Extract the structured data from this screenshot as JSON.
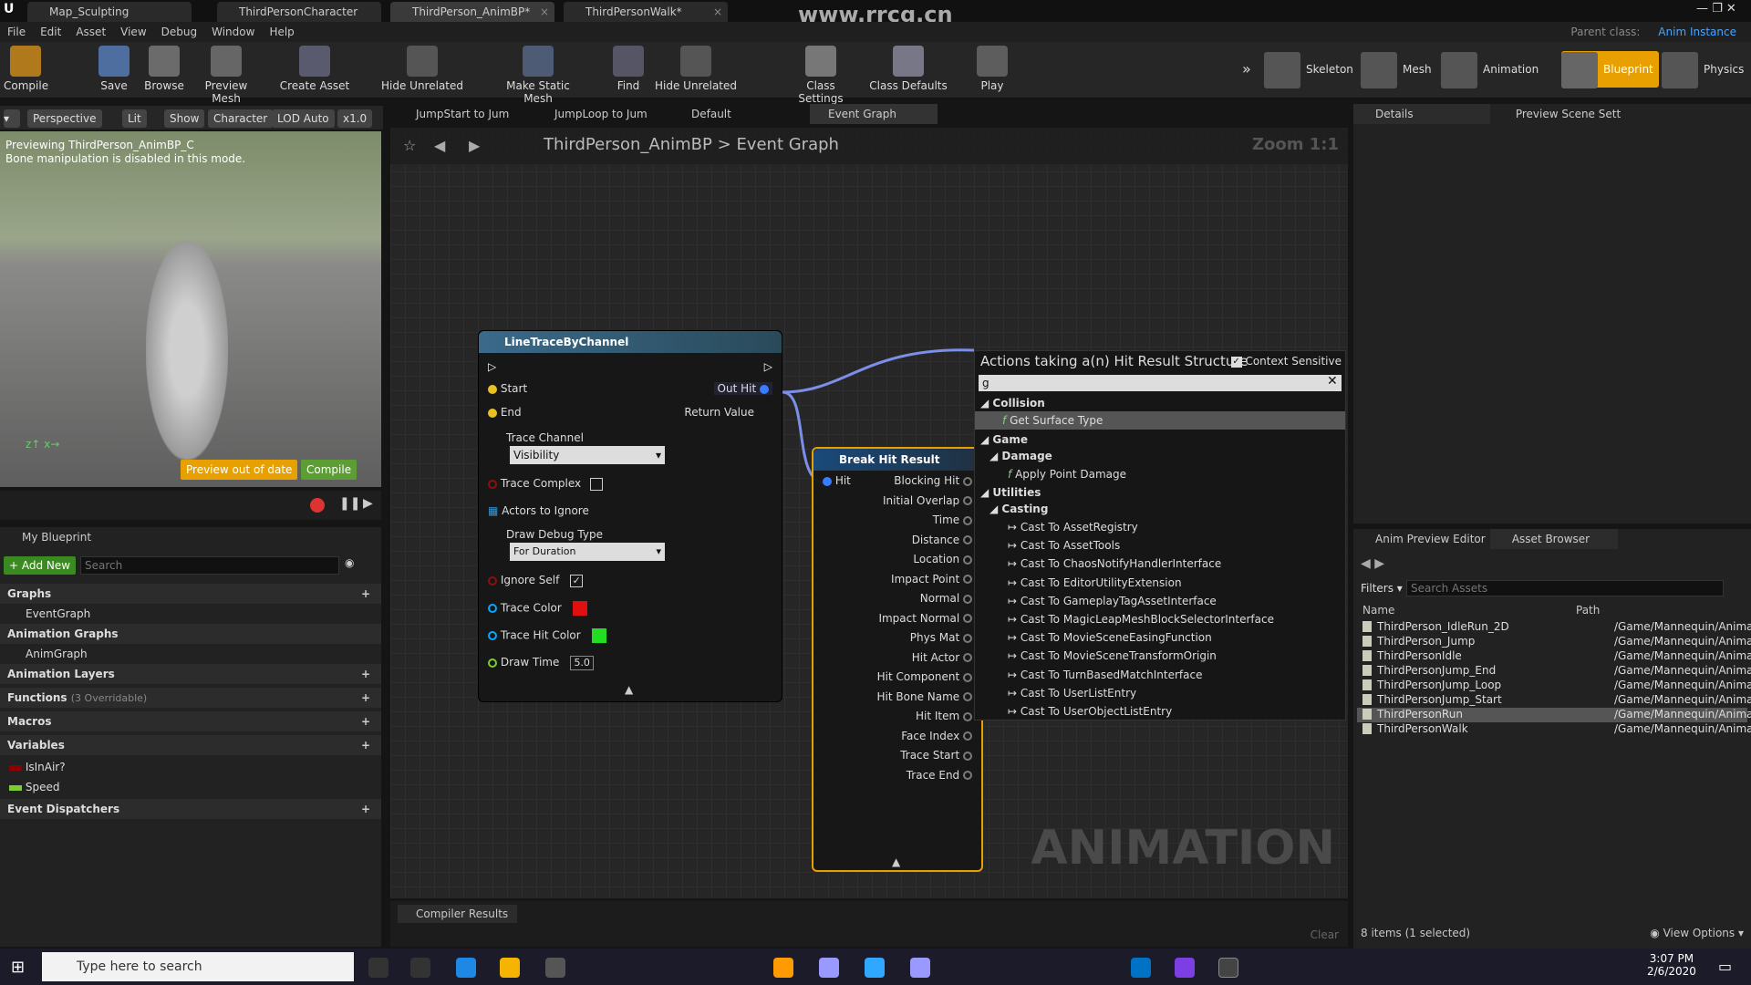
{
  "tabs": [
    {
      "label": "Map_Sculpting"
    },
    {
      "label": "ThirdPersonCharacter"
    },
    {
      "label": "ThirdPerson_AnimBP*"
    },
    {
      "label": "ThirdPersonWalk*"
    }
  ],
  "watermark": "www.rrcg.cn",
  "parent_class": {
    "label": "Parent class:",
    "value": "Anim Instance"
  },
  "menu": [
    "File",
    "Edit",
    "Asset",
    "View",
    "Debug",
    "Window",
    "Help"
  ],
  "toolbar": [
    "Compile",
    "Save",
    "Browse",
    "Preview Mesh",
    "Create Asset",
    "Hide Unrelated",
    "Make Static Mesh",
    "Find",
    "Hide Unrelated",
    "Class Settings",
    "Class Defaults",
    "Play"
  ],
  "modes": [
    "Skeleton",
    "Mesh",
    "Animation",
    "Blueprint",
    "Physics"
  ],
  "viewport": {
    "buttons": [
      "Perspective",
      "Lit",
      "Show",
      "Character",
      "LOD Auto",
      "x1.0"
    ],
    "info1": "Previewing ThirdPerson_AnimBP_C",
    "info2": "Bone manipulation is disabled in this mode.",
    "out_of_date": "Preview out of date",
    "compile": "Compile"
  },
  "graph_tabs": [
    "JumpStart to Jum",
    "JumpLoop to Jum",
    "Default",
    "Event Graph"
  ],
  "breadcrumb": {
    "asset": "ThirdPerson_AnimBP",
    "sep": ">",
    "graph": "Event Graph"
  },
  "zoom": "Zoom 1:1",
  "graph_watermark": "ANIMATION",
  "trace_node": {
    "title": "LineTraceByChannel",
    "start": "Start",
    "end": "End",
    "out_hit": "Out Hit",
    "return_value": "Return Value",
    "trace_channel": "Trace Channel",
    "channel_value": "Visibility",
    "trace_complex": "Trace Complex",
    "actors": "Actors to Ignore",
    "debug_type": "Draw Debug Type",
    "debug_value": "For Duration",
    "ignore_self": "Ignore Self",
    "trace_color": "Trace Color",
    "hit_color": "Trace Hit Color",
    "draw_time": "Draw Time",
    "draw_time_value": "5.0",
    "trace_color_hex": "#e01010",
    "hit_color_hex": "#22dd22"
  },
  "break_node": {
    "title": "Break Hit Result",
    "hit": "Hit",
    "outputs": [
      "Blocking Hit",
      "Initial Overlap",
      "Time",
      "Distance",
      "Location",
      "Impact Point",
      "Normal",
      "Impact Normal",
      "Phys Mat",
      "Hit Actor",
      "Hit Component",
      "Hit Bone Name",
      "Hit Item",
      "Face Index",
      "Trace Start",
      "Trace End"
    ]
  },
  "action_menu": {
    "title": "Actions taking a(n) Hit Result Structure",
    "context": "Context Sensitive",
    "search": "g",
    "categories": {
      "collision": "Collision",
      "game": "Game",
      "damage": "Damage",
      "utilities": "Utilities",
      "casting": "Casting"
    },
    "collision_items": [
      "Get Surface Type"
    ],
    "damage_items": [
      "Apply Point Damage"
    ],
    "casting_items": [
      "Cast To AssetRegistry",
      "Cast To AssetTools",
      "Cast To ChaosNotifyHandlerInterface",
      "Cast To EditorUtilityExtension",
      "Cast To GameplayTagAssetInterface",
      "Cast To MagicLeapMeshBlockSelectorInterface",
      "Cast To MovieSceneEasingFunction",
      "Cast To MovieSceneTransformOrigin",
      "Cast To TurnBasedMatchInterface",
      "Cast To UserListEntry",
      "Cast To UserObjectListEntry"
    ]
  },
  "compiler_results": "Compiler Results",
  "clear": "Clear",
  "my_blueprint": {
    "title": "My Blueprint",
    "add_new": "+ Add New",
    "search": "Search",
    "sections": {
      "graphs": "Graphs",
      "event_graph": "EventGraph",
      "anim_graphs": "Animation Graphs",
      "anim_graph": "AnimGraph",
      "anim_layers": "Animation Layers",
      "functions": "Functions",
      "functions_note": "(3 Overridable)",
      "macros": "Macros",
      "variables": "Variables",
      "event_dispatchers": "Event Dispatchers"
    },
    "variables": [
      {
        "name": "IsInAir?",
        "color": "#8b0000"
      },
      {
        "name": "Speed",
        "color": "#7ccc33"
      }
    ]
  },
  "details": {
    "title": "Details",
    "scene": "Preview Scene Sett"
  },
  "asset_browser": {
    "tab1": "Anim Preview Editor",
    "tab2": "Asset Browser",
    "filters": "Filters",
    "search": "Search Assets",
    "col_name": "Name",
    "col_path": "Path",
    "items": [
      {
        "name": "ThirdPerson_IdleRun_2D",
        "path": "/Game/Mannequin/Anima"
      },
      {
        "name": "ThirdPerson_Jump",
        "path": "/Game/Mannequin/Anima"
      },
      {
        "name": "ThirdPersonIdle",
        "path": "/Game/Mannequin/Anima"
      },
      {
        "name": "ThirdPersonJump_End",
        "path": "/Game/Mannequin/Anima"
      },
      {
        "name": "ThirdPersonJump_Loop",
        "path": "/Game/Mannequin/Anima"
      },
      {
        "name": "ThirdPersonJump_Start",
        "path": "/Game/Mannequin/Anima"
      },
      {
        "name": "ThirdPersonRun",
        "path": "/Game/Mannequin/Anima"
      },
      {
        "name": "ThirdPersonWalk",
        "path": "/Game/Mannequin/Anima"
      }
    ],
    "status": "8 items (1 selected)",
    "view_options": "View Options"
  },
  "taskbar": {
    "search": "Type here to search",
    "time": "3:07 PM",
    "date": "2/6/2020"
  },
  "colors": {
    "accent": "#e8a000",
    "exec_blue": "#7b8fe8"
  }
}
